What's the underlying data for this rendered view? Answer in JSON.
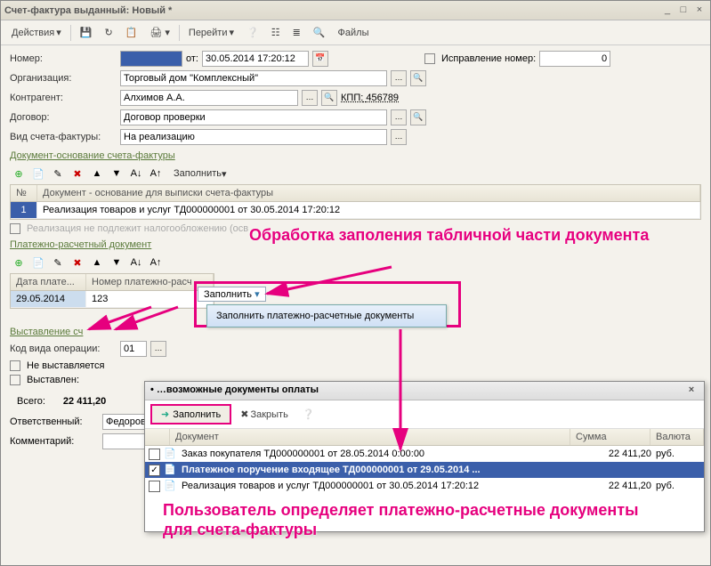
{
  "window": {
    "title": "Счет-фактура выданный: Новый *"
  },
  "toolbar": {
    "actions": "Действия",
    "go": "Перейти",
    "files": "Файлы"
  },
  "form": {
    "number_label": "Номер:",
    "from": "от:",
    "date": "30.05.2014 17:20:12",
    "correction_label": "Исправление номер:",
    "correction_value": "0",
    "org_label": "Организация:",
    "org": "Торговый дом \"Комплексный\"",
    "contr_label": "Контрагент:",
    "contr": "Алхимов А.А.",
    "kpp_label": "КПП:",
    "kpp": "456789",
    "contract_label": "Договор:",
    "contract": "Договор проверки",
    "type_label": "Вид счета-фактуры:",
    "type": "На реализацию"
  },
  "section1": {
    "title": "Документ-основание счета-фактуры",
    "fill": "Заполнить",
    "col_n": "№",
    "col_doc": "Документ - основание для выписки счета-фактуры",
    "row_n": "1",
    "row_doc": "Реализация товаров и услуг ТД000000001 от 30.05.2014 17:20:12",
    "exempt": "Реализация не подлежит налогообложению (осв"
  },
  "section2": {
    "title": "Платежно-расчетный документ",
    "fill": "Заполнить",
    "menu_item": "Заполнить платежно-расчетные документы",
    "col_date": "Дата плате...",
    "col_num": "Номер платежно-расч",
    "date": "29.05.2014",
    "num": "123"
  },
  "section3": {
    "title": "Выставление сч",
    "op_label": "Код вида операции:",
    "op": "01",
    "not_issued": "Не выставляется",
    "issued": "Выставлен:"
  },
  "totals": {
    "label": "Всего:",
    "value": "22 411,20"
  },
  "footer": {
    "resp_label": "Ответственный:",
    "resp": "Федоров Б",
    "comment_label": "Комментарий:"
  },
  "popup": {
    "title": "возможные документы оплаты",
    "fill": "Заполнить",
    "close": "Закрыть",
    "col_doc": "Документ",
    "col_sum": "Сумма",
    "col_cur": "Валюта",
    "rows": [
      {
        "doc": "Заказ покупателя ТД000000001 от 28.05.2014 0:00:00",
        "sum": "22 411,20",
        "cur": "руб."
      },
      {
        "doc": "Платежное поручение входящее ТД000000001 от 29.05.2014 ...",
        "sum": "",
        "cur": ""
      },
      {
        "doc": "Реализация товаров и услуг ТД000000001 от 30.05.2014 17:20:12",
        "sum": "22 411,20",
        "cur": "руб."
      }
    ]
  },
  "annotations": {
    "a1": "Обработка заполения табличной части документа",
    "a2": "Пользователь определяет платежно-расчетные документы для счета-фактуры"
  }
}
